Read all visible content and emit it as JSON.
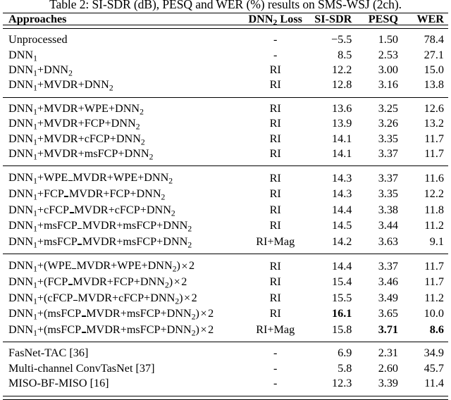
{
  "caption": "Table 2: SI-SDR (dB), PESQ and WER (%) results on SMS-WSJ (2ch).",
  "header": {
    "approaches": "Approaches",
    "loss": "DNN2 Loss",
    "loss_main": "DNN",
    "loss_sub": "2",
    "loss_tail": " Loss",
    "sisdr": "SI-SDR",
    "pesq": "PESQ",
    "wer": "WER"
  },
  "chart_data": {
    "type": "table",
    "title": "Table 2: SI-SDR (dB), PESQ and WER (%) results on SMS-WSJ (2ch).",
    "columns": [
      "Approaches",
      "DNN2 Loss",
      "SI-SDR",
      "PESQ",
      "WER"
    ],
    "units": {
      "SI-SDR": "dB",
      "WER": "%"
    },
    "rows": [
      {
        "approach": "Unprocessed",
        "loss": "-",
        "sisdr": "−5.5",
        "pesq": "1.50",
        "wer": "78.4"
      },
      {
        "approach": "DNN1",
        "loss": "-",
        "sisdr": "8.5",
        "pesq": "2.53",
        "wer": "27.1"
      },
      {
        "approach": "DNN1+DNN2",
        "loss": "RI",
        "sisdr": "12.2",
        "pesq": "3.00",
        "wer": "15.0"
      },
      {
        "approach": "DNN1+MVDR+DNN2",
        "loss": "RI",
        "sisdr": "12.8",
        "pesq": "3.16",
        "wer": "13.8"
      },
      {
        "approach": "DNN1+MVDR+WPE+DNN2",
        "loss": "RI",
        "sisdr": "13.6",
        "pesq": "3.25",
        "wer": "12.6"
      },
      {
        "approach": "DNN1+MVDR+FCP+DNN2",
        "loss": "RI",
        "sisdr": "13.9",
        "pesq": "3.26",
        "wer": "13.2"
      },
      {
        "approach": "DNN1+MVDR+cFCP+DNN2",
        "loss": "RI",
        "sisdr": "14.1",
        "pesq": "3.35",
        "wer": "11.7"
      },
      {
        "approach": "DNN1+MVDR+msFCP+DNN2",
        "loss": "RI",
        "sisdr": "14.1",
        "pesq": "3.37",
        "wer": "11.7"
      },
      {
        "approach": "DNN1+WPE_MVDR+WPE+DNN2",
        "loss": "RI",
        "sisdr": "14.3",
        "pesq": "3.37",
        "wer": "11.6"
      },
      {
        "approach": "DNN1+FCP_MVDR+FCP+DNN2",
        "loss": "RI",
        "sisdr": "14.3",
        "pesq": "3.35",
        "wer": "12.2"
      },
      {
        "approach": "DNN1+cFCP_MVDR+cFCP+DNN2",
        "loss": "RI",
        "sisdr": "14.4",
        "pesq": "3.38",
        "wer": "11.8"
      },
      {
        "approach": "DNN1+msFCP_MVDR+msFCP+DNN2",
        "loss": "RI",
        "sisdr": "14.5",
        "pesq": "3.44",
        "wer": "11.2"
      },
      {
        "approach": "DNN1+msFCP_MVDR+msFCP+DNN2",
        "loss": "RI+Mag",
        "sisdr": "14.2",
        "pesq": "3.63",
        "wer": "9.1"
      },
      {
        "approach": "DNN1+(WPE_MVDR+WPE+DNN2)×2",
        "loss": "RI",
        "sisdr": "14.4",
        "pesq": "3.37",
        "wer": "11.7"
      },
      {
        "approach": "DNN1+(FCP_MVDR+FCP+DNN2)×2",
        "loss": "RI",
        "sisdr": "15.4",
        "pesq": "3.46",
        "wer": "11.7"
      },
      {
        "approach": "DNN1+(cFCP_MVDR+cFCP+DNN2)×2",
        "loss": "RI",
        "sisdr": "15.5",
        "pesq": "3.49",
        "wer": "11.2"
      },
      {
        "approach": "DNN1+(msFCP_MVDR+msFCP+DNN2)×2",
        "loss": "RI",
        "sisdr": "16.1",
        "pesq": "3.65",
        "wer": "10.0"
      },
      {
        "approach": "DNN1+(msFCP_MVDR+msFCP+DNN2)×2",
        "loss": "RI+Mag",
        "sisdr": "15.8",
        "pesq": "3.71",
        "wer": "8.6"
      },
      {
        "approach": "FasNet-TAC [36]",
        "loss": "-",
        "sisdr": "6.9",
        "pesq": "2.31",
        "wer": "34.9"
      },
      {
        "approach": "Multi-channel ConvTasNet [37]",
        "loss": "-",
        "sisdr": "5.8",
        "pesq": "2.60",
        "wer": "45.7"
      },
      {
        "approach": "MISO-BF-MISO [16]",
        "loss": "-",
        "sisdr": "12.3",
        "pesq": "3.39",
        "wer": "11.4"
      }
    ],
    "bold_cells": [
      {
        "row": 16,
        "column": "SI-SDR",
        "value": "16.1"
      },
      {
        "row": 17,
        "column": "PESQ",
        "value": "3.71"
      },
      {
        "row": 17,
        "column": "WER",
        "value": "8.6"
      }
    ]
  },
  "blocks": [
    {
      "rows": [
        {
          "sisdr": "−5.5",
          "pesq": "1.50",
          "wer": "78.4",
          "loss": "-"
        },
        {
          "sisdr": "8.5",
          "pesq": "2.53",
          "wer": "27.1",
          "loss": "-"
        },
        {
          "sisdr": "12.2",
          "pesq": "3.00",
          "wer": "15.0",
          "loss": "RI"
        },
        {
          "sisdr": "12.8",
          "pesq": "3.16",
          "wer": "13.8",
          "loss": "RI"
        }
      ]
    },
    {
      "rows": [
        {
          "sisdr": "13.6",
          "pesq": "3.25",
          "wer": "12.6",
          "loss": "RI"
        },
        {
          "sisdr": "13.9",
          "pesq": "3.26",
          "wer": "13.2",
          "loss": "RI"
        },
        {
          "sisdr": "14.1",
          "pesq": "3.35",
          "wer": "11.7",
          "loss": "RI"
        },
        {
          "sisdr": "14.1",
          "pesq": "3.37",
          "wer": "11.7",
          "loss": "RI"
        }
      ]
    },
    {
      "rows": [
        {
          "sisdr": "14.3",
          "pesq": "3.37",
          "wer": "11.6",
          "loss": "RI"
        },
        {
          "sisdr": "14.3",
          "pesq": "3.35",
          "wer": "12.2",
          "loss": "RI"
        },
        {
          "sisdr": "14.4",
          "pesq": "3.38",
          "wer": "11.8",
          "loss": "RI"
        },
        {
          "sisdr": "14.5",
          "pesq": "3.44",
          "wer": "11.2",
          "loss": "RI"
        },
        {
          "sisdr": "14.2",
          "pesq": "3.63",
          "wer": "9.1",
          "loss": "RI+Mag"
        }
      ]
    },
    {
      "rows": [
        {
          "sisdr": "14.4",
          "pesq": "3.37",
          "wer": "11.7",
          "loss": "RI"
        },
        {
          "sisdr": "15.4",
          "pesq": "3.46",
          "wer": "11.7",
          "loss": "RI"
        },
        {
          "sisdr": "15.5",
          "pesq": "3.49",
          "wer": "11.2",
          "loss": "RI"
        },
        {
          "sisdr": "16.1",
          "pesq": "3.65",
          "wer": "10.0",
          "loss": "RI"
        },
        {
          "sisdr": "15.8",
          "pesq": "3.71",
          "wer": "8.6",
          "loss": "RI+Mag"
        }
      ]
    },
    {
      "rows": [
        {
          "approach": "FasNet-TAC [36]",
          "sisdr": "6.9",
          "pesq": "2.31",
          "wer": "34.9",
          "loss": "-"
        },
        {
          "approach": "Multi-channel ConvTasNet [37]",
          "sisdr": "5.8",
          "pesq": "2.60",
          "wer": "45.7",
          "loss": "-"
        },
        {
          "approach": "MISO-BF-MISO [16]",
          "sisdr": "12.3",
          "pesq": "3.39",
          "wer": "11.4",
          "loss": "-"
        }
      ]
    }
  ]
}
